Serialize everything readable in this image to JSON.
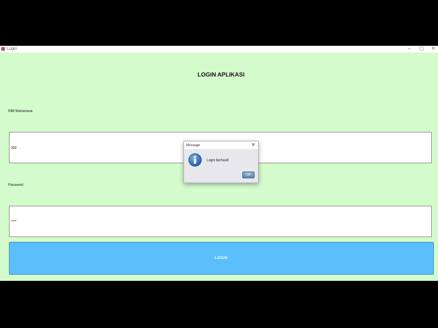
{
  "window": {
    "title": "Login",
    "minimize": "–",
    "maximize": "▢",
    "close": "✕"
  },
  "form": {
    "heading": "LOGIN APLIKASI",
    "nim_label": "NIM Mahasiswa",
    "nim_value": "300",
    "password_label": "Password",
    "password_value": "****",
    "login_button": "LOGIN"
  },
  "dialog": {
    "title": "Message",
    "close": "✕",
    "message": "Login berhasil!",
    "ok_button": "OK",
    "icon": "info-icon"
  },
  "colors": {
    "background": "#d4fbcb",
    "login_button": "#5bbffb"
  }
}
